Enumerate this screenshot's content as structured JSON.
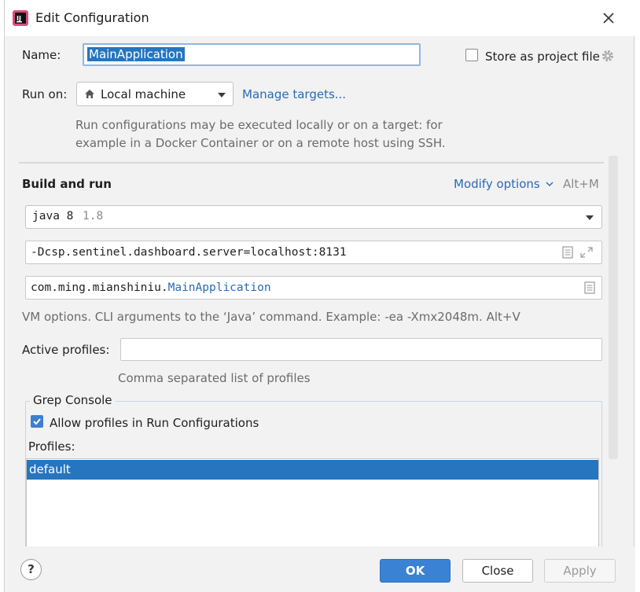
{
  "window": {
    "title": "Edit Configuration"
  },
  "name_row": {
    "label": "Name:",
    "value": "MainApplication"
  },
  "store_as_project_file": {
    "label": "Store as project file",
    "checked": false
  },
  "run_on": {
    "label": "Run on:",
    "value": "Local machine",
    "manage_link": "Manage targets..."
  },
  "run_on_hint": {
    "line1": "Run configurations may be executed locally or on a target: for",
    "line2": "example in a Docker Container or on a remote host using SSH."
  },
  "build_and_run": {
    "title": "Build and run",
    "modify_options": "Modify options",
    "modify_shortcut": "Alt+M",
    "jdk": {
      "name": "java 8",
      "version": "1.8"
    },
    "vm_options": "-Dcsp.sentinel.dashboard.server=localhost:8131",
    "main_class": {
      "package": "com.ming.mianshiniu.",
      "class": "MainApplication"
    },
    "vm_hint": "VM options. CLI arguments to the ‘Java’ command. Example: -ea -Xmx2048m. Alt+V"
  },
  "active_profiles": {
    "label": "Active profiles:",
    "value": "",
    "hint": "Comma separated list of profiles"
  },
  "grep_console": {
    "title": "Grep Console",
    "allow_profiles": {
      "label": "Allow profiles in Run Configurations",
      "checked": true
    },
    "profiles_label": "Profiles:",
    "profiles": [
      "default"
    ]
  },
  "footer": {
    "help": "?",
    "ok": "OK",
    "close": "Close",
    "apply": "Apply"
  },
  "colors": {
    "accent": "#3a82d4",
    "selection": "#2675bf",
    "link": "#2a6bb5"
  }
}
